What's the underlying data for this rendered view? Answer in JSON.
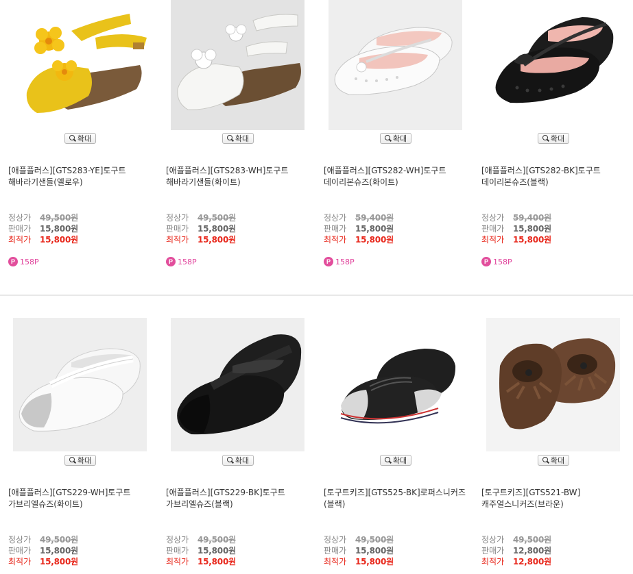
{
  "labels": {
    "zoom": "확대",
    "regular_price": "정상가",
    "sale_price": "판매가",
    "best_price": "최적가",
    "point_badge": "P"
  },
  "colors": {
    "best_price": "#e8281c",
    "point": "#e24e9c",
    "divider": "#e8e8e8"
  },
  "products": [
    {
      "title": "[애플플러스][GTS283-YE]토구트 해바라기샌들(옐로우)",
      "regular": "49,500원",
      "sale": "15,800원",
      "best": "15,800원",
      "point": "158P",
      "image": "yellow-flower-sandal"
    },
    {
      "title": "[애플플러스][GTS283-WH]토구트 해바라기샌들(화이트)",
      "regular": "49,500원",
      "sale": "15,800원",
      "best": "15,800원",
      "point": "158P",
      "image": "white-flower-sandal"
    },
    {
      "title": "[애플플러스][GTS282-WH]토구트 데이리본슈즈(화이트)",
      "regular": "59,400원",
      "sale": "15,800원",
      "best": "15,800원",
      "point": "158P",
      "image": "white-ribbon-shoe"
    },
    {
      "title": "[애플플러스][GTS282-BK]토구트 데이리본슈즈(블랙)",
      "regular": "59,400원",
      "sale": "15,800원",
      "best": "15,800원",
      "point": "158P",
      "image": "black-ribbon-shoe"
    },
    {
      "title": "[애플플러스][GTS229-WH]토구트 가브리엘슈즈(화이트)",
      "regular": "49,500원",
      "sale": "15,800원",
      "best": "15,800원",
      "image": "white-mary-jane"
    },
    {
      "title": "[애플플러스][GTS229-BK]토구트 가브리엘슈즈(블랙)",
      "regular": "49,500원",
      "sale": "15,800원",
      "best": "15,800원",
      "image": "black-mary-jane"
    },
    {
      "title": "[토구트키즈][GTS525-BK]로퍼스니커즈(블랙)",
      "regular": "49,500원",
      "sale": "15,800원",
      "best": "15,800원",
      "image": "black-loafer-sneaker"
    },
    {
      "title": "[토구트키즈][GTS521-BW]캐주얼스니커즈(브라운)",
      "regular": "49,500원",
      "sale": "12,800원",
      "best": "12,800원",
      "image": "brown-casual-sneaker"
    }
  ]
}
